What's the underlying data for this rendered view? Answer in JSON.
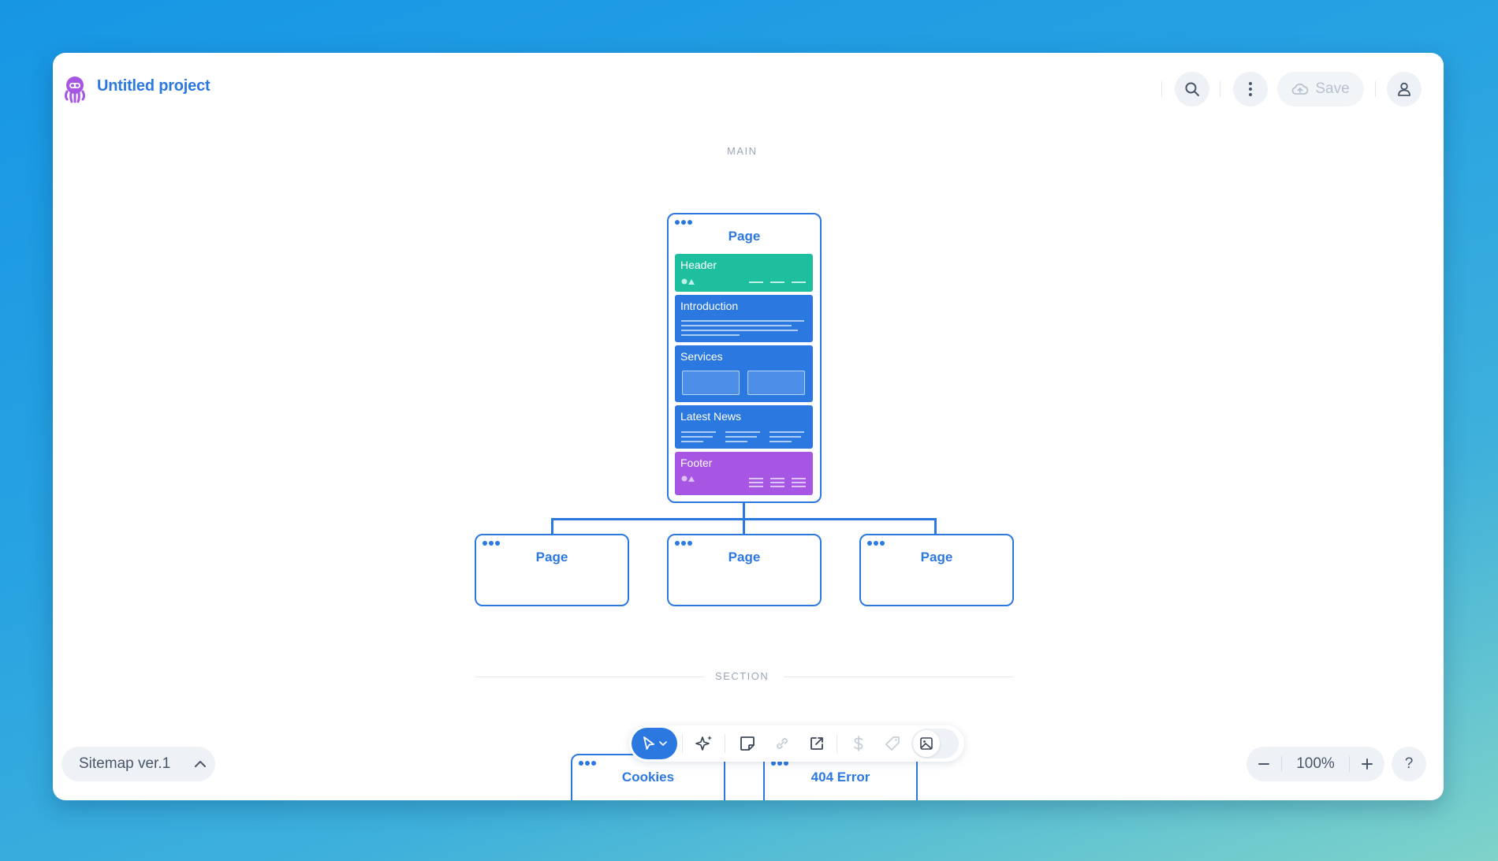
{
  "header": {
    "project_title": "Untitled project",
    "save_label": "Save",
    "icons": [
      "octopus-logo-icon",
      "search-icon",
      "more-vertical-icon",
      "cloud-upload-icon",
      "user-icon"
    ]
  },
  "canvas": {
    "main_label": "MAIN",
    "section_label": "SECTION",
    "home_page": {
      "title": "Page",
      "blocks": [
        {
          "label": "Header",
          "color": "#1dbf9f"
        },
        {
          "label": "Introduction",
          "color": "#2b78e0"
        },
        {
          "label": "Services",
          "color": "#2b78e0"
        },
        {
          "label": "Latest News",
          "color": "#2b78e0"
        },
        {
          "label": "Footer",
          "color": "#a755e3"
        }
      ]
    },
    "child_pages": [
      {
        "title": "Page"
      },
      {
        "title": "Page"
      },
      {
        "title": "Page"
      }
    ],
    "section_pages": [
      {
        "title": "Cookies"
      },
      {
        "title": "404 Error"
      }
    ]
  },
  "bottom": {
    "sitemap_label": "Sitemap ver.1",
    "zoom_level": "100%",
    "help_label": "?"
  },
  "toolbar": {
    "tools": [
      "select-pointer-icon",
      "ai-sparkle-icon",
      "sticky-note-icon",
      "link-icon",
      "external-link-icon",
      "dollar-icon",
      "tag-icon",
      "image-icon"
    ]
  },
  "colors": {
    "accent": "#2b78e0",
    "header_block": "#1dbf9f",
    "footer_block": "#a755e3"
  }
}
